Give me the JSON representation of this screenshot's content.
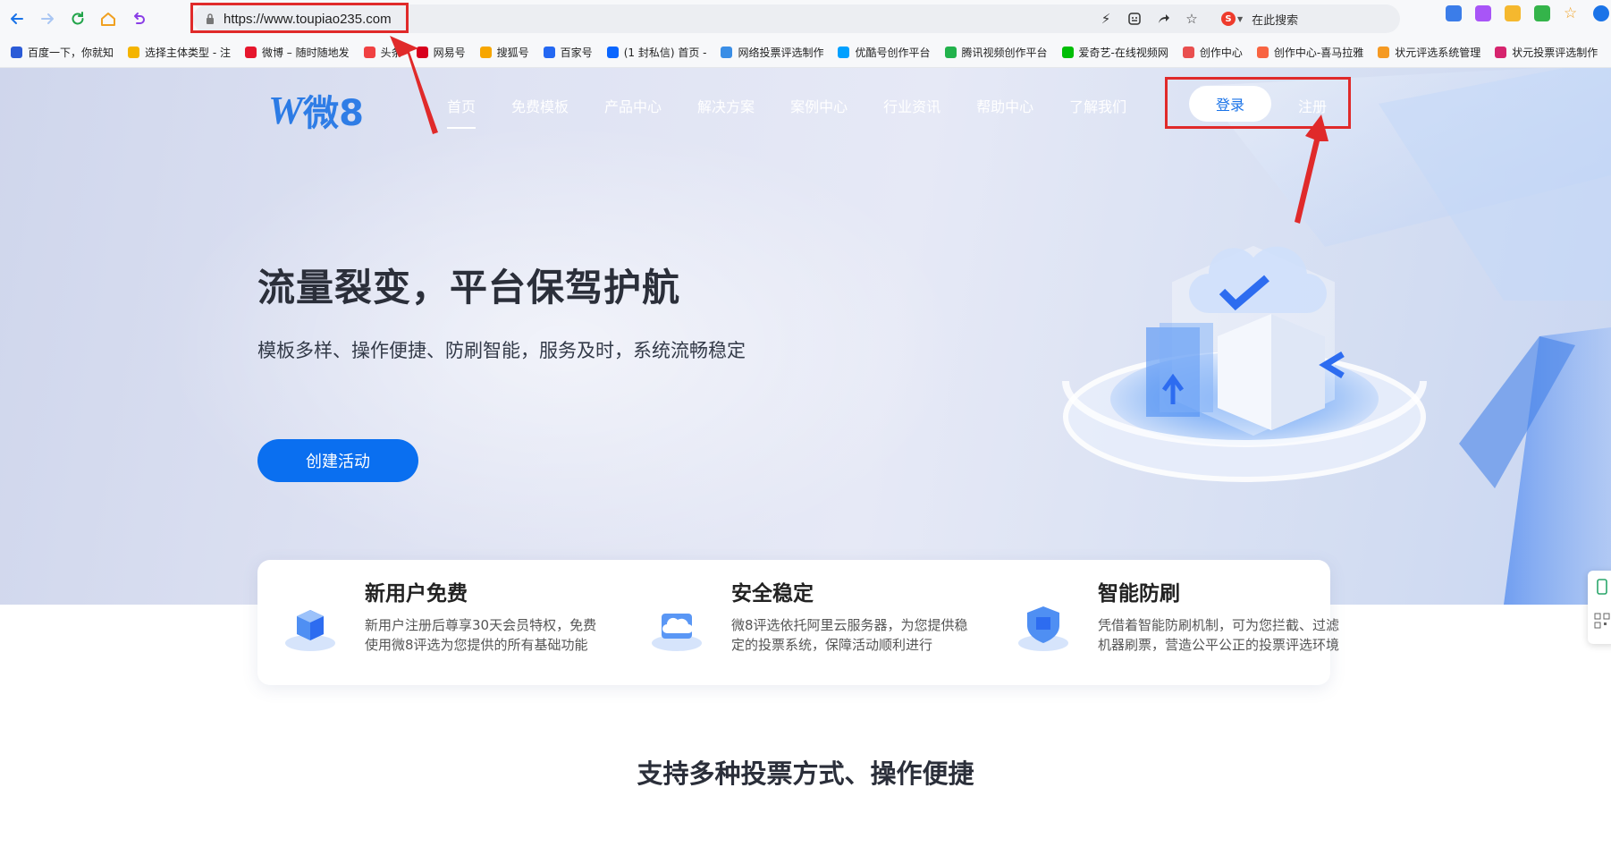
{
  "browser": {
    "url": "https://www.toupiao235.com",
    "search_placeholder": "在此搜索",
    "bookmarks": [
      {
        "label": "百度一下，你就知",
        "icon": "baidu-paw-icon",
        "color": "#2b5bd7"
      },
      {
        "label": "选择主体类型 - 注",
        "icon": "bell-icon",
        "color": "#f4b400"
      },
      {
        "label": "微博 – 随时随地发",
        "icon": "weibo-icon",
        "color": "#e6162d"
      },
      {
        "label": "头条",
        "icon": "toutiao-icon",
        "color": "#f04142"
      },
      {
        "label": "网易号",
        "icon": "netease-icon",
        "color": "#d8001e"
      },
      {
        "label": "搜狐号",
        "icon": "sohu-icon",
        "color": "#f7a600"
      },
      {
        "label": "百家号",
        "icon": "baijia-icon",
        "color": "#2468f2"
      },
      {
        "label": "(1 封私信) 首页 -",
        "icon": "zhihu-icon",
        "color": "#0a66ff"
      },
      {
        "label": "网络投票评选制作",
        "icon": "tv-icon",
        "color": "#3a8ee6"
      },
      {
        "label": "优酷号创作平台",
        "icon": "youku-icon",
        "color": "#00a0ff"
      },
      {
        "label": "腾讯视频创作平台",
        "icon": "tencent-video-icon",
        "color": "#22b24c"
      },
      {
        "label": "爱奇艺-在线视频网",
        "icon": "iqiyi-icon",
        "color": "#00be06"
      },
      {
        "label": "创作中心",
        "icon": "creator-icon",
        "color": "#e94f4f"
      },
      {
        "label": "创作中心-喜马拉雅",
        "icon": "ximalaya-icon",
        "color": "#f86442"
      },
      {
        "label": "状元评选系统管理",
        "icon": "box-icon",
        "color": "#f59a23"
      },
      {
        "label": "状元投票评选制作",
        "icon": "hp-icon",
        "color": "#d6246e"
      }
    ]
  },
  "site": {
    "logo_text": "微8",
    "logo_mark": "W",
    "nav": [
      "首页",
      "免费模板",
      "产品中心",
      "解决方案",
      "案例中心",
      "行业资讯",
      "帮助中心",
      "了解我们"
    ],
    "login": "登录",
    "register": "注册"
  },
  "hero": {
    "title": "流量裂变，平台保驾护航",
    "subtitle": "模板多样、操作便捷、防刷智能，服务及时，系统流畅稳定",
    "cta": "创建活动"
  },
  "features": [
    {
      "title": "新用户免费",
      "desc": "新用户注册后尊享30天会员特权，免费使用微8评选为您提供的所有基础功能",
      "icon": "cubes-icon"
    },
    {
      "title": "安全稳定",
      "desc": "微8评选依托阿里云服务器，为您提供稳定的投票系统，保障活动顺利进行",
      "icon": "cloud-server-icon"
    },
    {
      "title": "智能防刷",
      "desc": "凭借着智能防刷机制，可为您拦截、过滤机器刷票，营造公平公正的投票评选环境",
      "icon": "shield-icon"
    }
  ],
  "section_title": "支持多种投票方式、操作便捷",
  "colors": {
    "accent": "#0a6ff0",
    "annotation": "#e02a2a"
  }
}
